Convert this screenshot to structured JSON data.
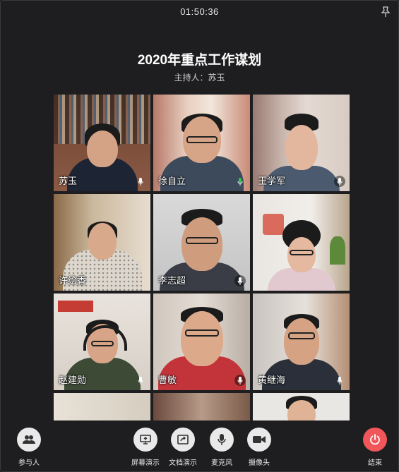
{
  "status_bar": {
    "time": "01:50:36"
  },
  "meeting": {
    "title": "2020年重点工作谋划",
    "host_label": "主持人：苏玉"
  },
  "participants": [
    {
      "name": "苏玉",
      "mic": "on"
    },
    {
      "name": "徐自立",
      "mic": "active"
    },
    {
      "name": "王学军",
      "mic": "on"
    },
    {
      "name": "许绘香",
      "mic": "on"
    },
    {
      "name": "李志超",
      "mic": "on"
    },
    {
      "name": "",
      "mic": "none"
    },
    {
      "name": "赵建勋",
      "mic": "on"
    },
    {
      "name": "曹敏",
      "mic": "on"
    },
    {
      "name": "黄继海",
      "mic": "on"
    },
    {
      "name": "",
      "mic": "none"
    },
    {
      "name": "",
      "mic": "none"
    },
    {
      "name": "",
      "mic": "none"
    }
  ],
  "toolbar": {
    "participants": "参与人",
    "screen_share": "屏幕演示",
    "doc_share": "文档演示",
    "microphone": "麦克风",
    "camera": "摄像头",
    "end": "结束"
  },
  "icons": [
    "pin-icon",
    "microphone-icon",
    "participants-icon",
    "screen-share-icon",
    "document-share-icon",
    "camera-icon",
    "power-icon"
  ],
  "colors": {
    "background": "#1e1e20",
    "end_button": "#f0565a",
    "mic_active": "#35c24a"
  }
}
